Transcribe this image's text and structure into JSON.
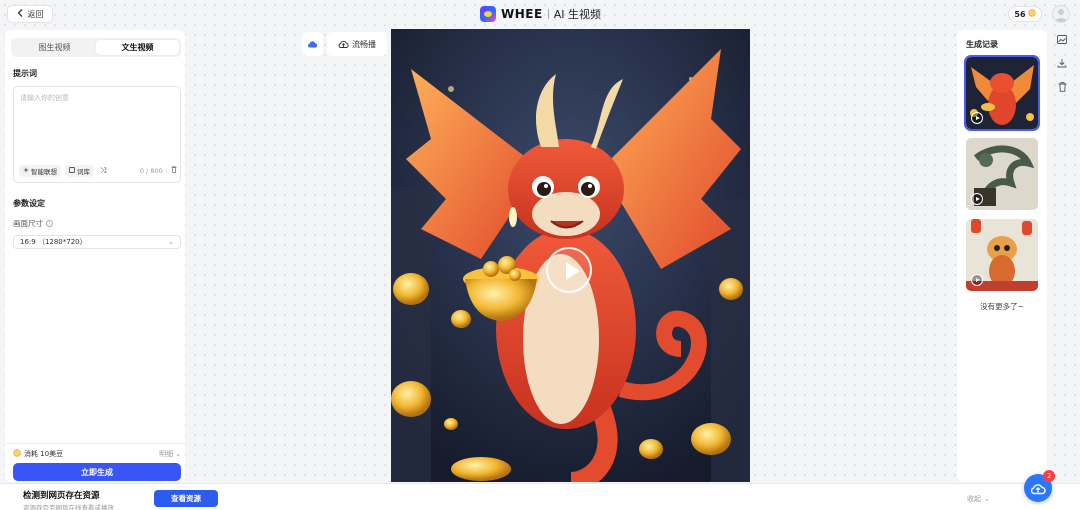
{
  "header": {
    "back_label": "返回",
    "brand_name": "WHEE",
    "page_title": "AI 生视频",
    "credits": "56"
  },
  "left_panel": {
    "tabs": [
      {
        "label": "图生视频",
        "active": false
      },
      {
        "label": "文生视频",
        "active": true
      }
    ],
    "prompt_label": "提示词",
    "prompt_placeholder": "请输入你的创意",
    "smart_assoc_label": "智能联想",
    "lexicon_label": "词库",
    "char_count": "0 / 800",
    "params_label": "参数设定",
    "size_label": "画面尺寸",
    "size_value": "16:9 （1280*720）",
    "cost_label": "消耗 10美豆",
    "detail_label": "明细",
    "generate_label": "立即生成"
  },
  "canvas_tools": {
    "smooth_label": "流畅播"
  },
  "right_panel": {
    "title": "生成记录",
    "no_more": "没有更多了~"
  },
  "bottom_bar": {
    "title": "检测到网页存在资源",
    "subtitle": "资源存夸克网盘在线查看或播放",
    "button_label": "查看资源",
    "collapse_label": "收起",
    "badge_count": "2"
  },
  "icons": {
    "back": "chevron-left-icon",
    "credits": "coin-icon",
    "avatar": "user-icon",
    "side": [
      "image-icon",
      "download-icon",
      "trash-icon"
    ],
    "fab": "cloud-upload-icon"
  },
  "colors": {
    "primary": "#3a55f6",
    "fab": "#2a78ff",
    "badge": "#ff3b3b",
    "selected_outline": "#4a5cf5"
  }
}
